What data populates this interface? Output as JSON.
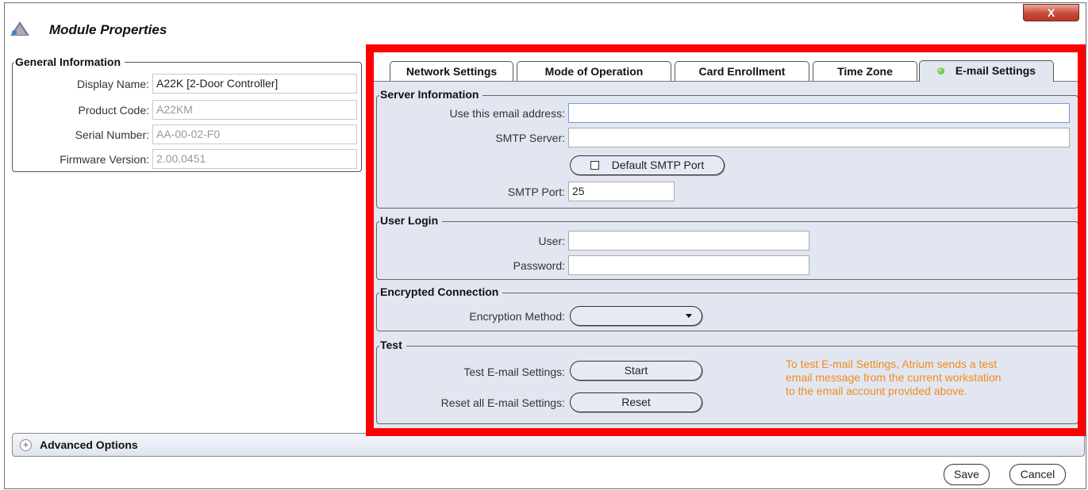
{
  "window": {
    "title": "Module Properties",
    "close_label": "X"
  },
  "general": {
    "legend": "General Information",
    "fields": [
      {
        "label": "Display Name:",
        "value": "A22K [2-Door Controller]"
      },
      {
        "label": "Product Code:",
        "value": "A22KM"
      },
      {
        "label": "Serial Number:",
        "value": "AA-00-02-F0"
      },
      {
        "label": "Firmware Version:",
        "value": "2.00.0451"
      }
    ]
  },
  "tabs": [
    {
      "label": "Network Settings",
      "active": false
    },
    {
      "label": "Mode of Operation",
      "active": false
    },
    {
      "label": "Card Enrollment",
      "active": false
    },
    {
      "label": "Time Zone",
      "active": false
    },
    {
      "label": "E-mail Settings",
      "active": true
    }
  ],
  "server": {
    "title": "Server Information",
    "email_label": "Use this email address:",
    "email_value": "",
    "smtp_server_label": "SMTP Server:",
    "smtp_server_value": "",
    "default_port_label": "Default SMTP Port",
    "smtp_port_label": "SMTP Port:",
    "smtp_port_value": "25"
  },
  "login": {
    "title": "User Login",
    "user_label": "User:",
    "user_value": "",
    "password_label": "Password:",
    "password_value": ""
  },
  "encryption": {
    "title": "Encrypted Connection",
    "method_label": "Encryption Method:",
    "method_value": ""
  },
  "test": {
    "title": "Test",
    "test_label": "Test E-mail Settings:",
    "start_label": "Start",
    "reset_all_label": "Reset all E-mail Settings:",
    "reset_label": "Reset",
    "note": "To test E-mail Settings, Atrium sends a test\nemail message from the current workstation\nto the email account provided above."
  },
  "advanced": {
    "plus": "+",
    "label": "Advanced Options"
  },
  "footer": {
    "save_label": "Save",
    "cancel_label": "Cancel"
  },
  "colors": {
    "highlight_frame": "#ff0000",
    "note_text": "#f08c1a",
    "panel_bg": "#e2e6f1",
    "status_dot": "#35b021"
  }
}
